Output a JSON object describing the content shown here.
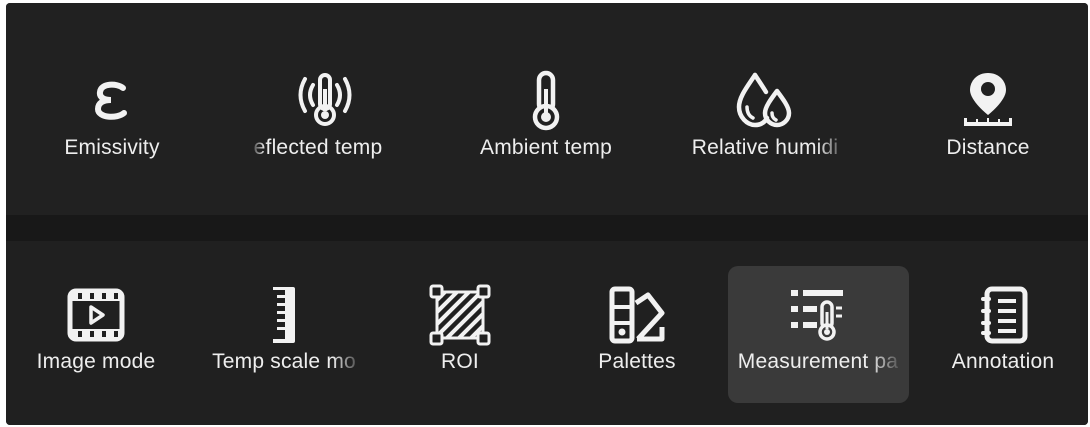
{
  "parameters_row": {
    "items": [
      {
        "label": "Emissivity",
        "icon": "epsilon-icon"
      },
      {
        "label": "eflected temp",
        "icon": "reflected-temp-icon"
      },
      {
        "label": "Ambient temp",
        "icon": "thermometer-icon"
      },
      {
        "label": "Relative humidi",
        "icon": "humidity-drops-icon"
      },
      {
        "label": "Distance",
        "icon": "location-pin-ruler-icon"
      }
    ]
  },
  "tools_row": {
    "items": [
      {
        "label": "Image mode",
        "icon": "film-play-icon"
      },
      {
        "label": "Temp scale mo",
        "icon": "ruler-scale-icon"
      },
      {
        "label": "ROI",
        "icon": "roi-region-icon"
      },
      {
        "label": "Palettes",
        "icon": "palette-swatches-icon"
      },
      {
        "label": "Measurement pa",
        "icon": "measurement-params-icon",
        "selected": true
      },
      {
        "label": "Annotation",
        "icon": "notebook-icon"
      }
    ]
  },
  "colors": {
    "background": "#1f1f1f",
    "text": "#eeeeee",
    "selected_bg": "#3a3a3a"
  }
}
